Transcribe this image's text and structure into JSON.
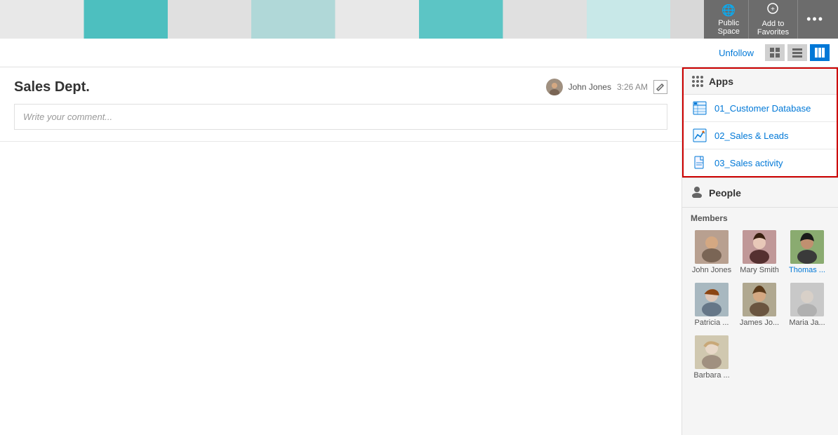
{
  "header": {
    "banner_alt": "Sales Department banner",
    "actions": [
      {
        "id": "public-space",
        "label": "Public\nSpace",
        "icon": "🌐"
      },
      {
        "id": "add-to-favorites",
        "label": "Add to\nFavorites",
        "icon": "★"
      },
      {
        "id": "more-options",
        "label": "•••",
        "icon": "···"
      }
    ]
  },
  "toolbar": {
    "unfollow_label": "Unfollow",
    "view_options": [
      "grid-view",
      "list-view",
      "column-view"
    ]
  },
  "post": {
    "title": "Sales Dept.",
    "author": "John Jones",
    "timestamp": "3:26 AM",
    "comment_placeholder": "Write your comment..."
  },
  "apps_section": {
    "title": "Apps",
    "items": [
      {
        "id": "app1",
        "name": "01_Customer Database",
        "icon_type": "table"
      },
      {
        "id": "app2",
        "name": "02_Sales & Leads",
        "icon_type": "chart"
      },
      {
        "id": "app3",
        "name": "03_Sales activity",
        "icon_type": "doc"
      }
    ]
  },
  "people_section": {
    "title": "People",
    "members_label": "Members",
    "members": [
      {
        "id": "m1",
        "name": "John Jones",
        "display": "John Jones",
        "color": "#b8a090"
      },
      {
        "id": "m2",
        "name": "Mary Smith",
        "display": "Mary Smith",
        "color": "#c0a0a0"
      },
      {
        "id": "m3",
        "name": "Thomas ...",
        "display": "Thomas ...",
        "color": "#8aab70"
      },
      {
        "id": "m4",
        "name": "Patricia ...",
        "display": "Patricia ...",
        "color": "#a0b0b8"
      },
      {
        "id": "m5",
        "name": "James Jo...",
        "display": "James Jo...",
        "color": "#b0a890"
      },
      {
        "id": "m6",
        "name": "Maria Ja...",
        "display": "Maria Ja...",
        "color": "#c8c8c8"
      },
      {
        "id": "m7",
        "name": "Barbara ...",
        "display": "Barbara ...",
        "color": "#d0c8b0"
      }
    ]
  }
}
